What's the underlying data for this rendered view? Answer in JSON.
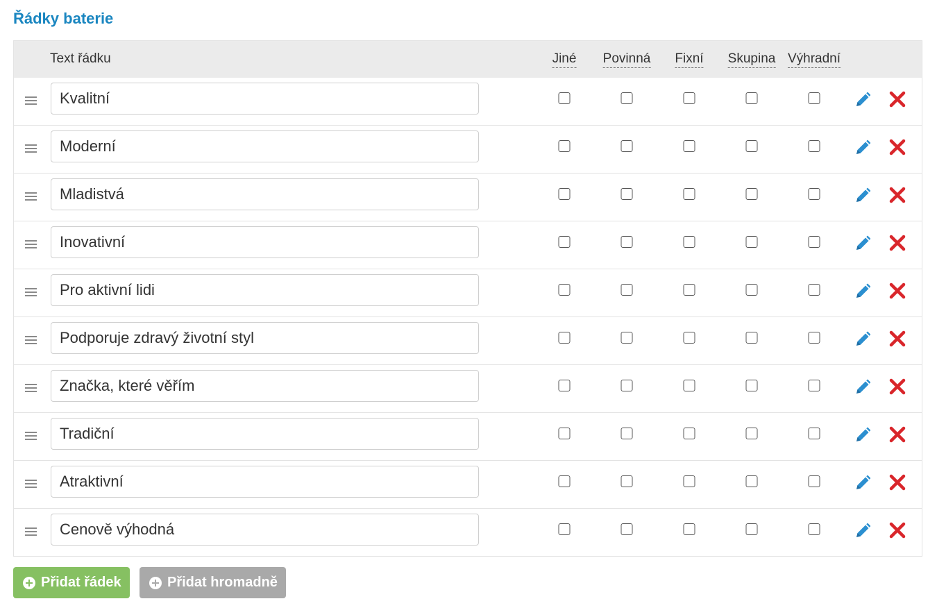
{
  "section": {
    "title": "Řádky baterie"
  },
  "header": {
    "text_col": "Text řádku",
    "columns": [
      "Jiné",
      "Povinná",
      "Fixní",
      "Skupina",
      "Výhradní"
    ]
  },
  "rows": [
    {
      "text": "Kvalitní",
      "checks": [
        false,
        false,
        false,
        false,
        false
      ]
    },
    {
      "text": "Moderní",
      "checks": [
        false,
        false,
        false,
        false,
        false
      ]
    },
    {
      "text": "Mladistvá",
      "checks": [
        false,
        false,
        false,
        false,
        false
      ]
    },
    {
      "text": "Inovativní",
      "checks": [
        false,
        false,
        false,
        false,
        false
      ]
    },
    {
      "text": "Pro aktivní lidi",
      "checks": [
        false,
        false,
        false,
        false,
        false
      ]
    },
    {
      "text": "Podporuje zdravý životní styl",
      "checks": [
        false,
        false,
        false,
        false,
        false
      ]
    },
    {
      "text": "Značka, které věřím",
      "checks": [
        false,
        false,
        false,
        false,
        false
      ]
    },
    {
      "text": "Tradiční",
      "checks": [
        false,
        false,
        false,
        false,
        false
      ]
    },
    {
      "text": "Atraktivní",
      "checks": [
        false,
        false,
        false,
        false,
        false
      ]
    },
    {
      "text": "Cenově výhodná",
      "checks": [
        false,
        false,
        false,
        false,
        false
      ]
    }
  ],
  "buttons": {
    "add_row": "Přidat řádek",
    "add_bulk": "Přidat hromadně"
  },
  "icons": {
    "drag": "drag-handle-icon",
    "edit": "pencil-icon",
    "delete": "close-icon",
    "add": "plus-circle-icon"
  },
  "colors": {
    "title": "#1a86c0",
    "edit": "#2b8fd0",
    "delete": "#d9262b",
    "add_button": "#86c062",
    "bulk_button": "#a9a9a9"
  }
}
